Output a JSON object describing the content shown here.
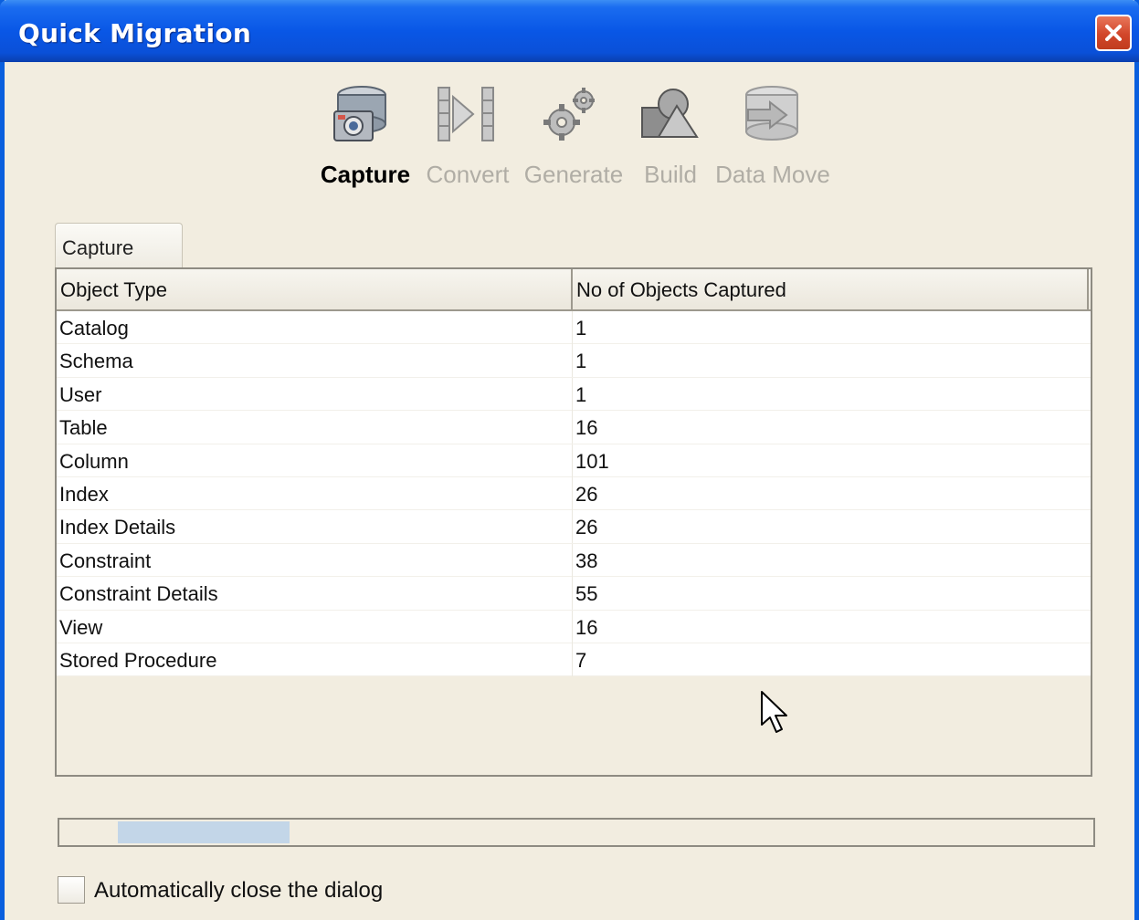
{
  "window": {
    "title": "Quick Migration"
  },
  "steps": [
    {
      "label": "Capture",
      "icon": "capture-database-camera-icon",
      "active": true
    },
    {
      "label": "Convert",
      "icon": "convert-arrow-icon",
      "active": false
    },
    {
      "label": "Generate",
      "icon": "generate-gears-icon",
      "active": false
    },
    {
      "label": "Build",
      "icon": "build-shapes-icon",
      "active": false
    },
    {
      "label": "Data Move",
      "icon": "data-move-database-icon",
      "active": false
    }
  ],
  "tab": {
    "label": "Capture"
  },
  "table": {
    "columns": [
      "Object Type",
      "No of Objects Captured"
    ],
    "rows": [
      [
        "Catalog",
        "1"
      ],
      [
        "Schema",
        "1"
      ],
      [
        "User",
        "1"
      ],
      [
        "Table",
        "16"
      ],
      [
        "Column",
        "101"
      ],
      [
        "Index",
        "26"
      ],
      [
        "Index Details",
        "26"
      ],
      [
        "Constraint",
        "38"
      ],
      [
        "Constraint Details",
        "55"
      ],
      [
        "View",
        "16"
      ],
      [
        "Stored Procedure",
        "7"
      ]
    ]
  },
  "progress": {
    "state": "indeterminate"
  },
  "auto_close": {
    "label": "Automatically close the dialog",
    "checked": false
  },
  "colors": {
    "titlebar": "#0957e6",
    "close": "#d2462a",
    "progress_fill": "#c3d6e8",
    "background": "#f2ede0"
  }
}
